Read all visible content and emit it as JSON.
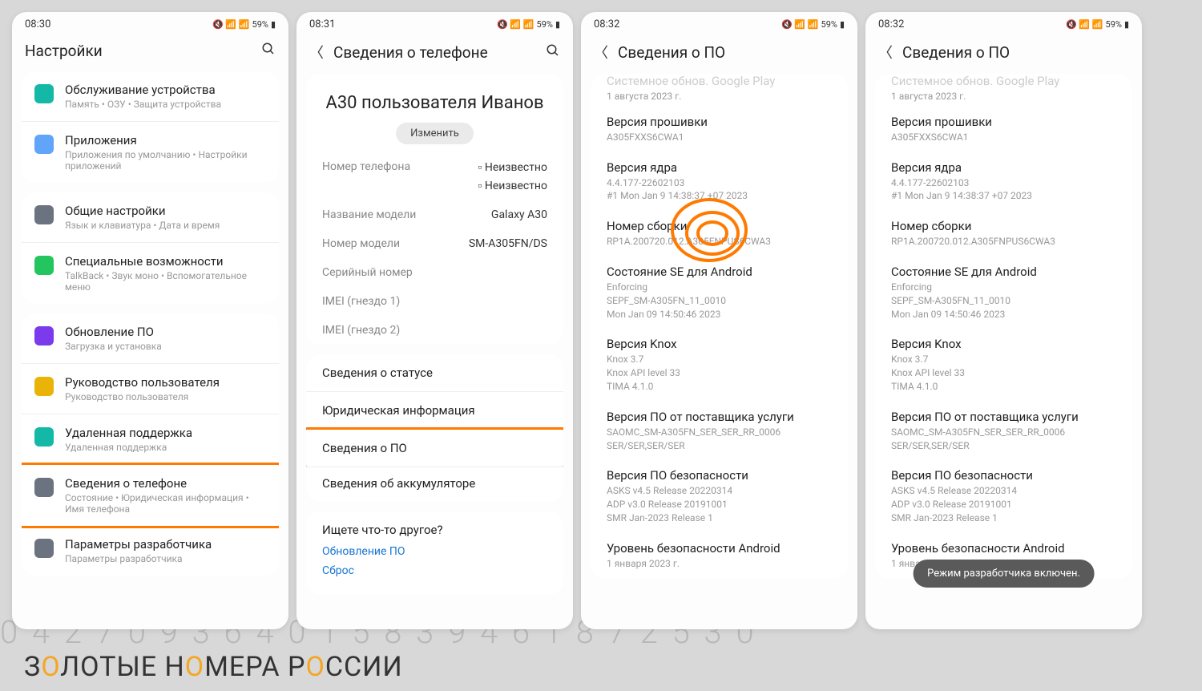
{
  "bg_numbers": "0 4 2 7 0 9 3 6 4 0 1 5 8 3 9 4 6 1 8 7 2 5 3 0",
  "watermark": [
    "З",
    "О",
    "ЛОТЫЕ Н",
    "О",
    "МЕРА Р",
    "О",
    "ССИИ"
  ],
  "status": {
    "battery": "59%"
  },
  "screen1": {
    "time": "08:30",
    "title": "Настройки",
    "items": [
      {
        "t": "Обслуживание устройства",
        "s": "Память • ОЗУ • Защита устройства",
        "c": "#14b8a6"
      },
      {
        "t": "Приложения",
        "s": "Приложения по умолчанию • Настройки приложений",
        "c": "#60a5fa"
      },
      {
        "t": "Общие настройки",
        "s": "Язык и клавиатура • Дата и время",
        "c": "#6b7280"
      },
      {
        "t": "Специальные возможности",
        "s": "TalkBack • Звук моно • Вспомогательное меню",
        "c": "#22c55e"
      },
      {
        "t": "Обновление ПО",
        "s": "Загрузка и установка",
        "c": "#7c3aed"
      },
      {
        "t": "Руководство пользователя",
        "s": "Руководство пользователя",
        "c": "#eab308"
      },
      {
        "t": "Удаленная поддержка",
        "s": "Удаленная поддержка",
        "c": "#14b8a6"
      },
      {
        "t": "Сведения о телефоне",
        "s": "Состояние • Юридическая информация • Имя телефона",
        "c": "#6b7280",
        "hl": true
      },
      {
        "t": "Параметры разработчика",
        "s": "Параметры разработчика",
        "c": "#6b7280"
      }
    ]
  },
  "screen2": {
    "time": "08:31",
    "title": "Сведения о телефоне",
    "device_name": "A30 пользователя Иванов",
    "edit": "Изменить",
    "specs": [
      {
        "l": "Номер телефона",
        "v": [
          "Неизвестно",
          "Неизвестно"
        ],
        "sim": true
      },
      {
        "l": "Название модели",
        "v": "Galaxy A30"
      },
      {
        "l": "Номер модели",
        "v": "SM-A305FN/DS"
      },
      {
        "l": "Серийный номер",
        "v": ""
      },
      {
        "l": "IMEI (гнездо 1)",
        "v": ""
      },
      {
        "l": "IMEI (гнездо 2)",
        "v": ""
      }
    ],
    "links": [
      "Сведения о статусе",
      "Юридическая информация",
      "Сведения о ПО",
      "Сведения об аккумуляторе"
    ],
    "hl_index": 2,
    "search_other": "Ищете что-то другое?",
    "search_links": [
      "Обновление ПО",
      "Сброс"
    ]
  },
  "screen3": {
    "time": "08:32",
    "title": "Сведения о ПО",
    "cutoff": {
      "t": "Системное обнов. Google Play",
      "s": "1 августа 2023 г."
    },
    "blocks": [
      {
        "t": "Версия прошивки",
        "s": "A305FXXS6CWA1"
      },
      {
        "t": "Версия ядра",
        "s": "4.4.177-22602103\n#1 Mon Jan 9 14:38:37 +07 2023"
      },
      {
        "t": "Номер сборки",
        "s": "RP1A.200720.012.A305FNPUS6CWA3",
        "ripple": true
      },
      {
        "t": "Состояние SE для Android",
        "s": "Enforcing\nSEPF_SM-A305FN_11_0010\nMon Jan 09 14:50:46 2023"
      },
      {
        "t": "Версия Knox",
        "s": "Knox 3.7\nKnox API level 33\nTIMA 4.1.0"
      },
      {
        "t": "Версия ПО от поставщика услуги",
        "s": "SAOMC_SM-A305FN_SER_SER_RR_0006\nSER/SER,SER/SER"
      },
      {
        "t": "Версия ПО безопасности",
        "s": "ASKS v4.5 Release 20220314\nADP v3.0 Release 20191001\nSMR Jan-2023 Release 1"
      },
      {
        "t": "Уровень безопасности Android",
        "s": "1 января 2023 г."
      }
    ]
  },
  "screen4": {
    "time": "08:32",
    "title": "Сведения о ПО",
    "cutoff": {
      "t": "Системное обнов. Google Play",
      "s": "1 августа 2023 г."
    },
    "blocks": [
      {
        "t": "Версия прошивки",
        "s": "A305FXXS6CWA1"
      },
      {
        "t": "Версия ядра",
        "s": "4.4.177-22602103\n#1 Mon Jan 9 14:38:37 +07 2023"
      },
      {
        "t": "Номер сборки",
        "s": "RP1A.200720.012.A305FNPUS6CWA3"
      },
      {
        "t": "Состояние SE для Android",
        "s": "Enforcing\nSEPF_SM-A305FN_11_0010\nMon Jan 09 14:50:46 2023"
      },
      {
        "t": "Версия Knox",
        "s": "Knox 3.7\nKnox API level 33\nTIMA 4.1.0"
      },
      {
        "t": "Версия ПО от поставщика услуги",
        "s": "SAOMC_SM-A305FN_SER_SER_RR_0006\nSER/SER,SER/SER"
      },
      {
        "t": "Версия ПО безопасности",
        "s": "ASKS v4.5 Release 20220314\nADP v3.0 Release 20191001\nSMR Jan-2023 Release 1"
      },
      {
        "t": "Уровень безопасности Android",
        "s": "1 января 2023 г."
      }
    ],
    "toast": "Режим разработчика включен."
  }
}
